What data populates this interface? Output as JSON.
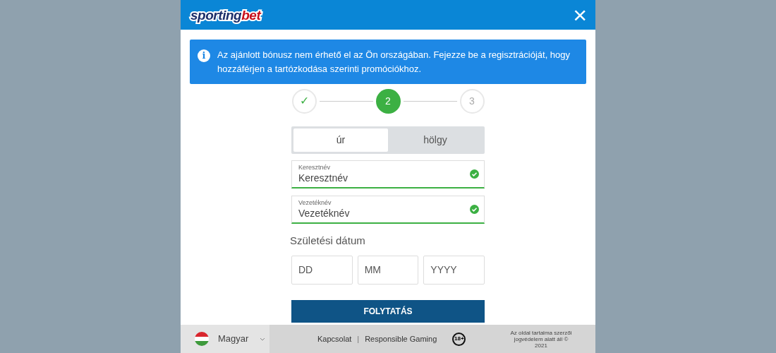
{
  "header": {
    "logo": {
      "first": "sporting",
      "second": "bet"
    },
    "close": "×"
  },
  "notice": {
    "icon": "i",
    "text": "Az ajánlott bónusz nem érhető el az Ön országában. Fejezze be a regisztrációját, hogy hozzáférjen a tartózkodása szerinti promóciókhoz."
  },
  "steps": [
    {
      "kind": "done",
      "label": "✓"
    },
    {
      "kind": "current",
      "label": "2"
    },
    {
      "kind": "upcoming",
      "label": "3"
    }
  ],
  "gender": [
    {
      "label": "úr",
      "selected": true
    },
    {
      "label": "hölgy",
      "selected": false
    }
  ],
  "fields": [
    {
      "label": "Keresztnév",
      "value": "Keresztnév",
      "valid": true
    },
    {
      "label": "Vezetéknév",
      "value": "Vezetéknév",
      "valid": true
    }
  ],
  "birth_date": {
    "label": "Születési dátum",
    "parts": [
      {
        "placeholder": "DD"
      },
      {
        "placeholder": "MM"
      },
      {
        "placeholder": "YYYY"
      }
    ]
  },
  "submit": "FOLYTATÁS",
  "footer": {
    "language": "Magyar",
    "links": [
      "Kapcsolat",
      "Responsible Gaming"
    ],
    "separator": "|",
    "age_badge": "18+",
    "copyright": "Az oldal tartalma szerzői jogvédelem alatt áll © 2021"
  }
}
